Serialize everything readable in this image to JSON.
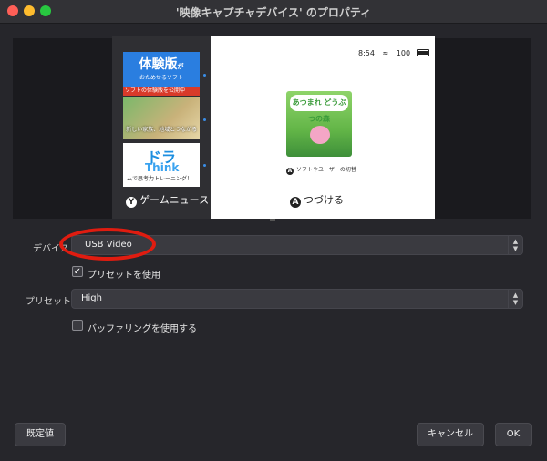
{
  "window": {
    "title": "'映像キャプチャデバイス' のプロパティ"
  },
  "preview": {
    "promo_title": "体験版",
    "promo_suffix": "が",
    "promo_sub": "おためせるソフト",
    "banner_text": "ソフトの体験版を公開中",
    "tile2_text": "新しい家族、地域とつながる",
    "tile3_title": "ドラ",
    "tile3_think": "Think",
    "tile3_sub": "ムで思考力トレーニング！",
    "news_button": "Y",
    "news_label": "ゲームニュース",
    "status_time": "8:54",
    "status_wifi": "≈",
    "status_battery": "100",
    "game_logo": "あつまれ どうぶつの森",
    "game_caption": "ソフトやユーザーの切替",
    "game_caption_button": "A",
    "continue_button": "A",
    "continue_label": "つづける"
  },
  "form": {
    "device_label": "デバイス",
    "device_value": "USB Video",
    "use_preset_label": "プリセットを使用",
    "use_preset_checked": true,
    "preset_label": "プリセット",
    "preset_value": "High",
    "buffering_label": "バッファリングを使用する",
    "buffering_checked": false
  },
  "buttons": {
    "defaults": "既定値",
    "cancel": "キャンセル",
    "ok": "OK"
  },
  "colors": {
    "annotation": "#e01c10",
    "promo": "#2a7ee0"
  }
}
